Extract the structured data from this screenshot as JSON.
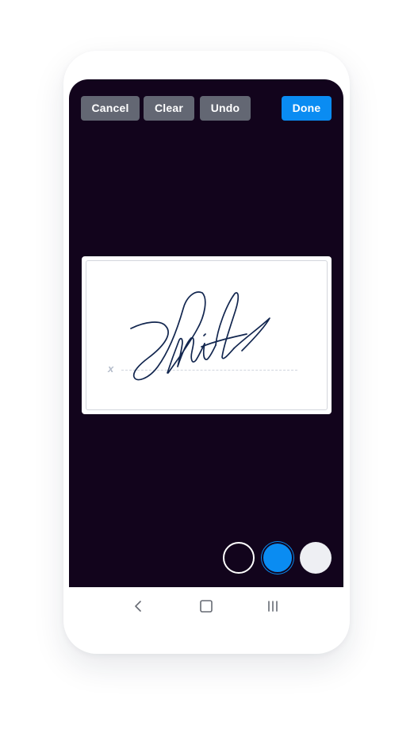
{
  "toolbar": {
    "cancel_label": "Cancel",
    "clear_label": "Clear",
    "undo_label": "Undo",
    "done_label": "Done"
  },
  "signature_pad": {
    "x_marker": "x",
    "signature_text": "Smith",
    "ink_color": "#12264f"
  },
  "colors": {
    "background": "#12041c",
    "button_gray": "#636773",
    "button_blue": "#0a8cf2",
    "swatches": [
      "#12041c",
      "#0a8cf2",
      "#eeeff3"
    ]
  },
  "navbar": {
    "icons": [
      "back-icon",
      "home-icon",
      "recents-icon"
    ]
  }
}
